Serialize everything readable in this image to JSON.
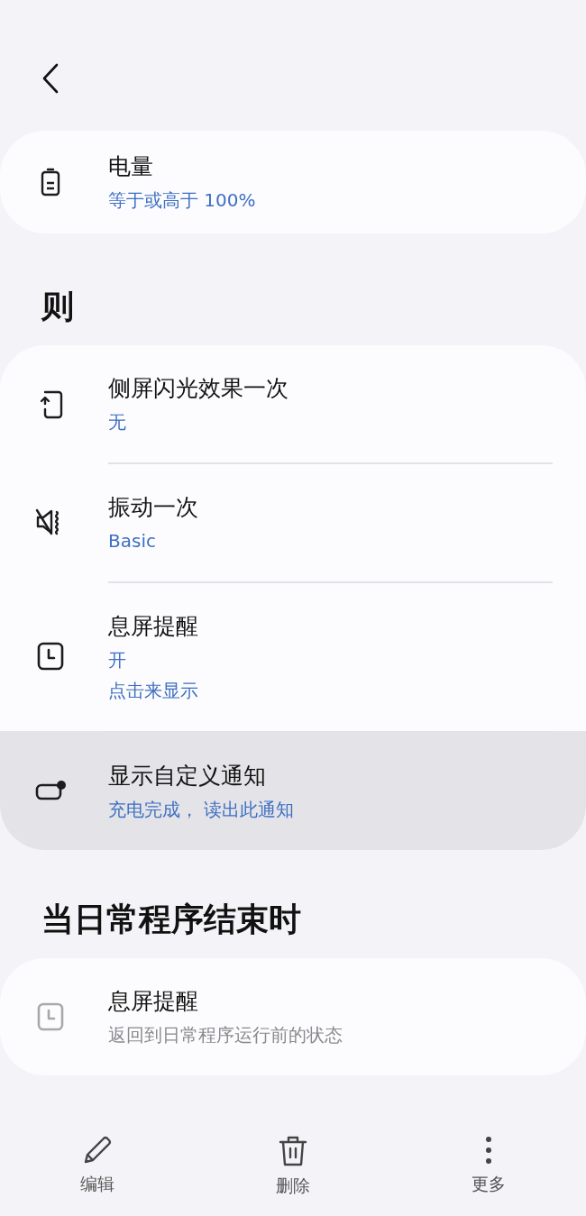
{
  "sections": [
    {
      "items": [
        {
          "title": "电量",
          "subtitles": [
            "等于或高于 100%"
          ],
          "pressed": false,
          "disabled": false
        }
      ]
    },
    {
      "heading": "则",
      "items": [
        {
          "title": "侧屏闪光效果一次",
          "subtitles": [
            "无"
          ],
          "pressed": false,
          "disabled": false
        },
        {
          "title": "振动一次",
          "subtitles": [
            "Basic"
          ],
          "pressed": false,
          "disabled": false
        },
        {
          "title": "息屏提醒",
          "subtitles": [
            "开",
            "点击来显示"
          ],
          "pressed": false,
          "disabled": false
        },
        {
          "title": "显示自定义通知",
          "subtitles": [
            "充电完成， 读出此通知"
          ],
          "pressed": true,
          "disabled": false
        }
      ]
    },
    {
      "heading": "当日常程序结束时",
      "items": [
        {
          "title": "息屏提醒",
          "subtitles": [
            "返回到日常程序运行前的状态"
          ],
          "pressed": false,
          "disabled": true
        }
      ]
    }
  ],
  "bottom_bar": [
    {
      "label": "编辑"
    },
    {
      "label": "删除"
    },
    {
      "label": "更多"
    }
  ]
}
